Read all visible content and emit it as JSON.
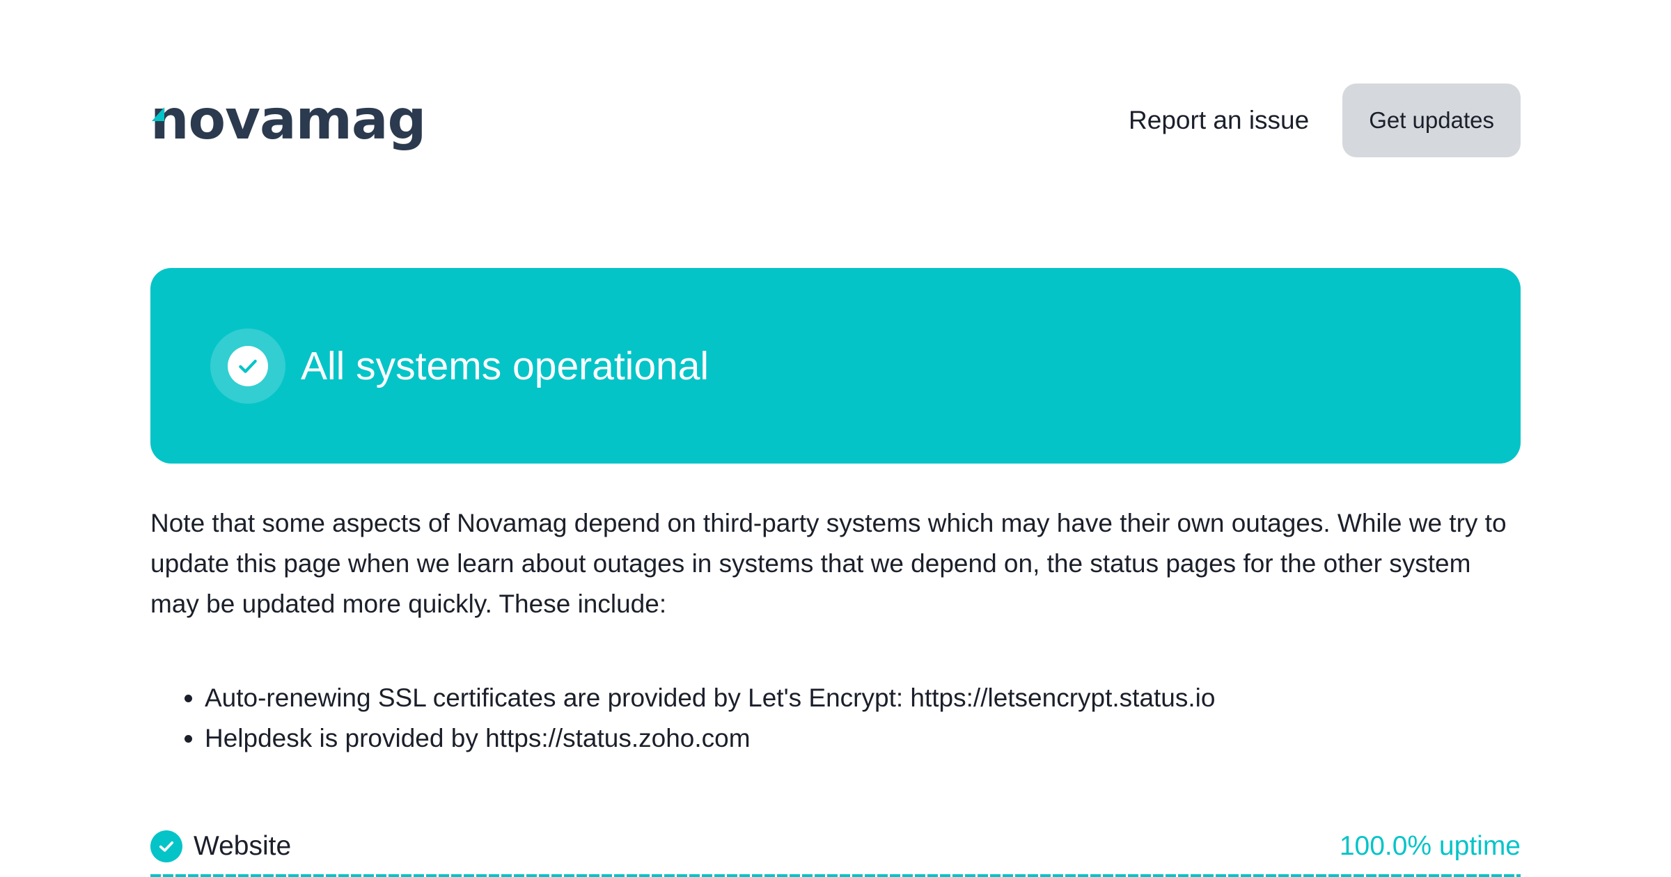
{
  "header": {
    "logo_text": "novamag",
    "report_link_label": "Report an issue",
    "updates_button_label": "Get updates"
  },
  "banner": {
    "title": "All systems operational"
  },
  "note": {
    "text": "Note that some aspects of Novamag depend on third-party systems which may have their own outages. While we try to update this page when we learn about outages in systems that we depend on, the status pages for the other system may be updated more quickly. These include:",
    "items": [
      "Auto-renewing SSL certificates are provided by Let's Encrypt: https://letsencrypt.status.io",
      "Helpdesk is provided by https://status.zoho.com"
    ]
  },
  "components": [
    {
      "name": "Website",
      "uptime": "100.0% uptime",
      "status_icon": "check-circle-icon"
    }
  ],
  "colors": {
    "accent": "#05c4c8",
    "logo": "#2b3a4e",
    "button_bg": "#d5d8dc",
    "text": "#1b1f2a"
  }
}
